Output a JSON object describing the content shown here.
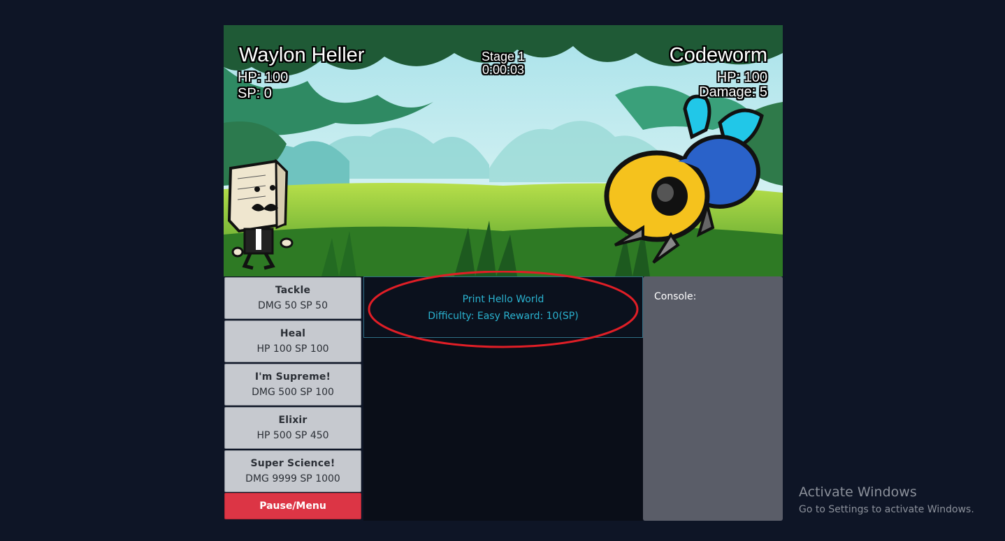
{
  "player": {
    "name": "Waylon Heller",
    "hp": "HP: 100",
    "sp": "SP: 0"
  },
  "stage": {
    "label": "Stage 1",
    "timer": "0:00:03"
  },
  "enemy": {
    "name": "Codeworm",
    "hp": "HP: 100",
    "damage": "Damage: 5"
  },
  "moves": [
    {
      "name": "Tackle",
      "stats": "DMG 50 SP 50"
    },
    {
      "name": "Heal",
      "stats": "HP 100 SP 100"
    },
    {
      "name": "I'm Supreme!",
      "stats": "DMG 500 SP 100"
    },
    {
      "name": "Elixir",
      "stats": "HP 500 SP 450"
    },
    {
      "name": "Super Science!",
      "stats": "DMG 9999 SP 1000"
    }
  ],
  "pause_label": "Pause/Menu",
  "challenge": {
    "title": "Print Hello World",
    "info": "Difficulty: Easy Reward: 10(SP)"
  },
  "console": {
    "label": "Console:"
  },
  "watermark": {
    "line1": "Activate Windows",
    "line2": "Go to Settings to activate Windows."
  },
  "colors": {
    "pause": "#dc3545",
    "challenge_text": "#2ab2cf",
    "annotation": "#e01e26"
  }
}
